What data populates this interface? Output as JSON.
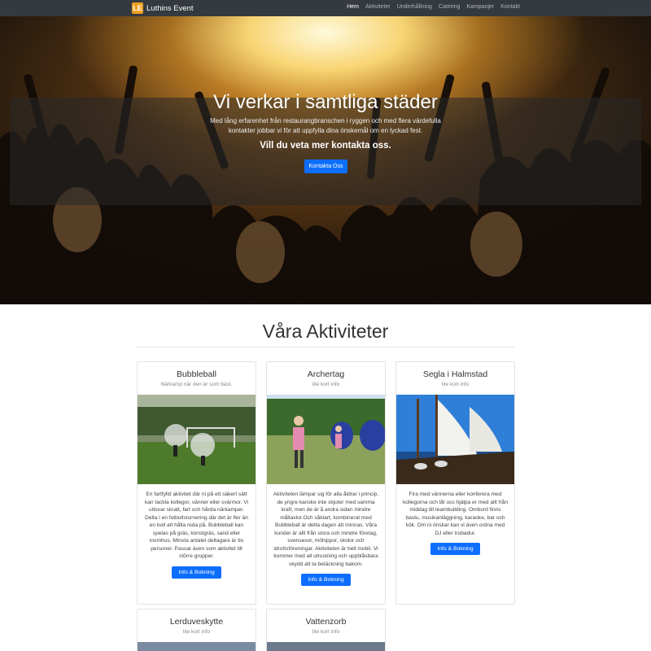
{
  "brand": {
    "logo": "LE",
    "name": "Luthins Event"
  },
  "nav": {
    "items": [
      "Hem",
      "Aktiviteter",
      "Underhållning",
      "Catering",
      "Kampanjer",
      "Kontakt"
    ]
  },
  "hero": {
    "title": "Vi verkar i samtliga städer",
    "text": "Med lång erfarenhet från restaurangbranschen i ryggen och med flera värdefulla kontakter jobbar vi för att uppfylla dina önskemål om en lyckad fest.",
    "subtitle": "Vill du veta mer kontakta oss.",
    "button": "Kontakta Oss"
  },
  "activities": {
    "title": "Våra Aktiviteter",
    "cards": [
      {
        "title": "Bubbleball",
        "subtitle": "Närkamp när den är som bäst.",
        "text": "En fartfylld aktivitet där ni på ett säkert sätt kan tackla kollegor, vänner eller svärmor. Vi utlovar skratt, fart och hårda närkamper. Delta i en fotbollsturnering där det är fler än en boll att hålla reda på. Bubbleball kan spelas på gräs, konstgräs, sand eller inomhus. Minsta antalet deltagare är tio personer. Passar även som aktivitet till större grupper.",
        "button": "Info & Bokning"
      },
      {
        "title": "Archertag",
        "subtitle": "lite kort info",
        "text": "Aktiviteten lämpar sig för alla åldrar i princip, de yngre kanske inte skjuter med samma kraft, men de är å andra sidan mindre måltavlor.Och såklart, kombinerat med Bubbleball är detta dagen att minnas. Våra kunder är allt från stora och mindre företag, svensexor, möhippor, skolor och idrottsföreningar. Aktiviteten är helt mobil. Vi kommer med all utrustning och uppblåsbara skydd att ta betäckning bakom.",
        "button": "Info & Bokning"
      },
      {
        "title": "Segla i Halmstad",
        "subtitle": "lite kort info",
        "text": "Fira med vännerna eller konferera med kollegorna och låt oss hjälpa er med allt från middag till teambuilding. Ombord finns bastu, musikanläggning, karaoke, bar och kök. Om ni önskar kan vi även ordna med DJ eller trubadur.",
        "button": "Info & Bokning"
      },
      {
        "title": "Lerduveskytte",
        "subtitle": "lite kort info"
      },
      {
        "title": "Vattenzorb",
        "subtitle": "lite kort info"
      }
    ]
  },
  "colors": {
    "navbar": "#343a40",
    "primary": "#0d6efd",
    "brand_logo": "#f0a020"
  },
  "icons": {
    "brand": "le-logo-icon"
  }
}
